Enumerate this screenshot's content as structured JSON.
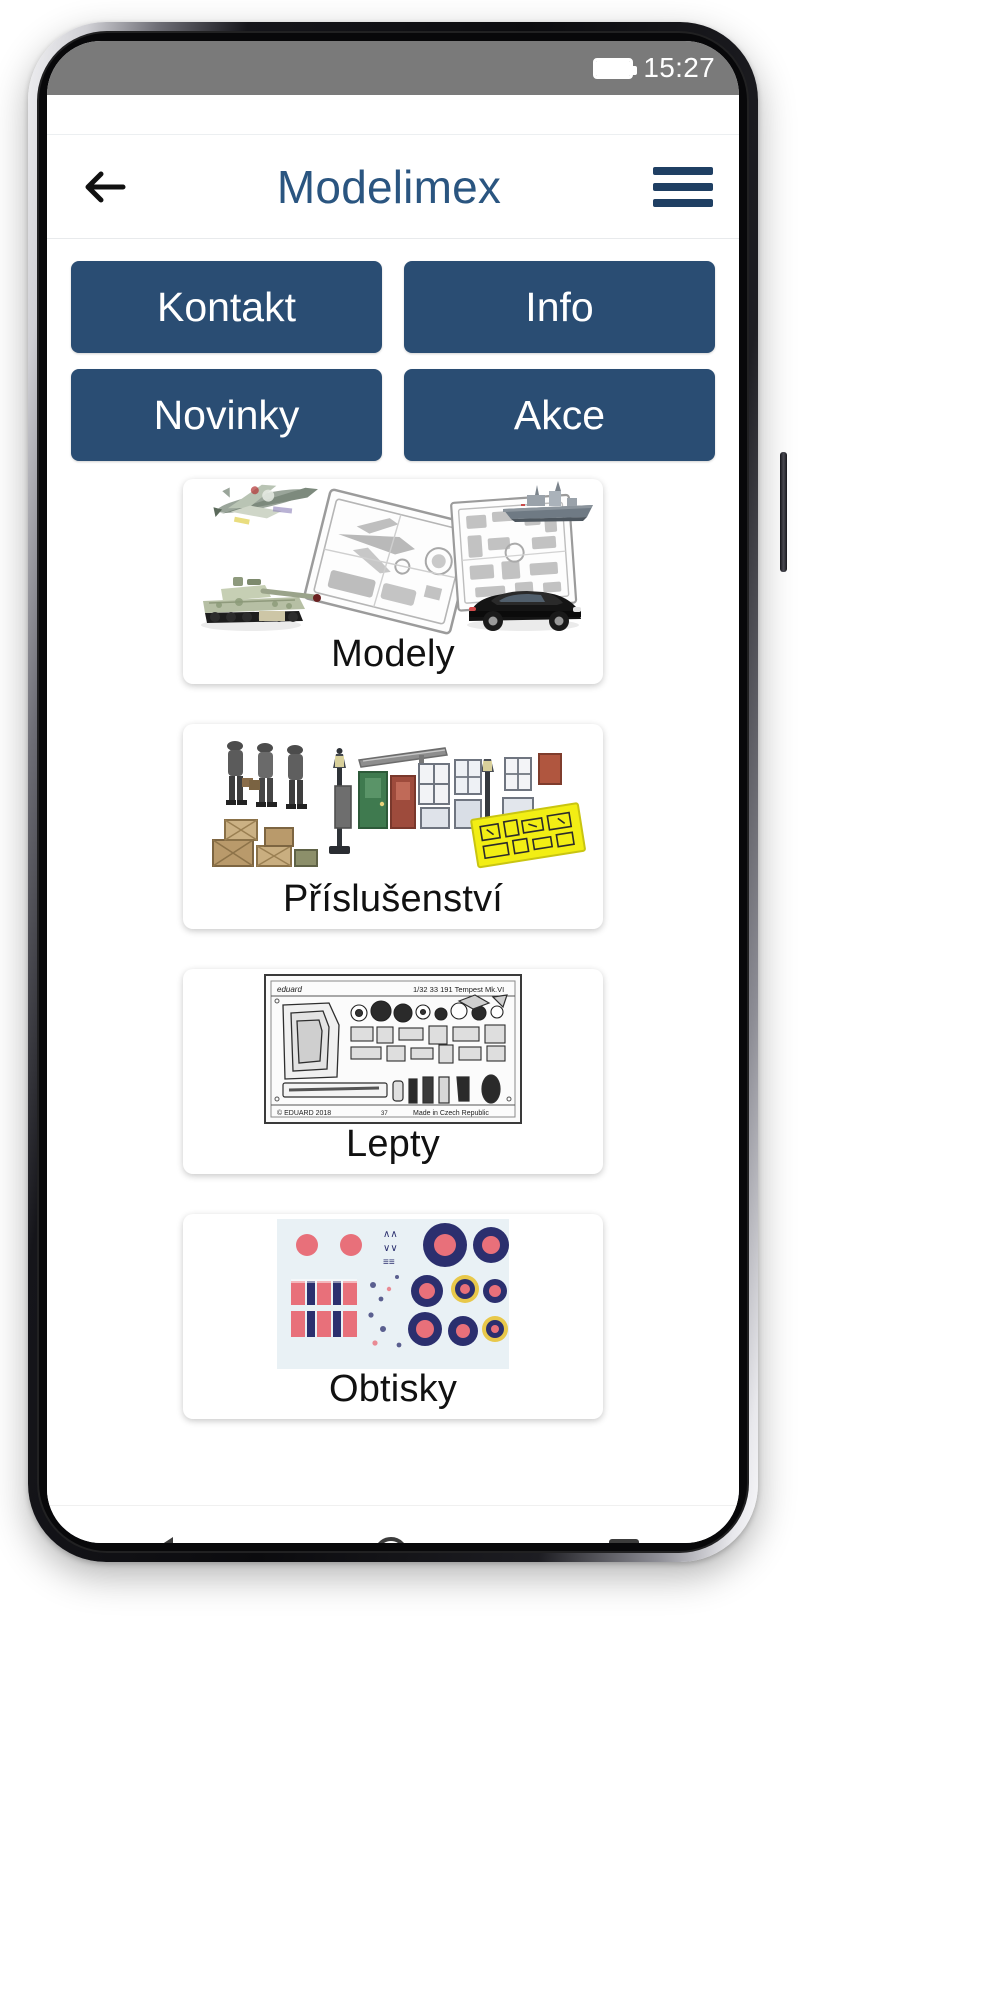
{
  "statusbar": {
    "time": "15:27",
    "battery_icon": "battery-icon"
  },
  "appbar": {
    "back_icon": "back-arrow-icon",
    "title": "Modelimex",
    "menu_icon": "hamburger-menu-icon"
  },
  "colors": {
    "brand_blue": "#2a4d73",
    "title_blue": "#2a5580",
    "statusbar_gray": "#7a7a7a",
    "card_label": "#111111",
    "page_background": "#ffffff"
  },
  "nav_buttons": [
    {
      "label": "Kontakt",
      "name": "kontakt"
    },
    {
      "label": "Info",
      "name": "info"
    },
    {
      "label": "Novinky",
      "name": "novinky"
    },
    {
      "label": "Akce",
      "name": "akce"
    }
  ],
  "categories": [
    {
      "label": "Modely",
      "name": "modely",
      "art": "model-kits-illustration",
      "art_items": [
        "airplane-model",
        "sprue-frame",
        "tank-model",
        "ship-model",
        "car-model"
      ]
    },
    {
      "label": "Příslušenství",
      "name": "prislusenstvi",
      "art": "accessories-illustration",
      "art_items": [
        "figures",
        "street-lamp",
        "doors-windows",
        "crates",
        "yellow-photoetch-sheet"
      ]
    },
    {
      "label": "Lepty",
      "name": "lepty",
      "art": "photo-etched-sheet-illustration",
      "sheet_header_left": "eduard",
      "sheet_header_right": "1/32   33 191   Tempest Mk.VI",
      "sheet_footer_left": "© EDUARD 2018",
      "sheet_footer_center": "37",
      "sheet_footer_right": "Made in Czech Republic"
    },
    {
      "label": "Obtisky",
      "name": "obtisky",
      "art": "decals-sheet-illustration",
      "art_items": [
        "roundels",
        "stripes",
        "markings"
      ]
    }
  ],
  "system_nav": {
    "back_label": "back-triangle-icon",
    "home_label": "home-circle-icon",
    "recents_label": "recents-square-icon"
  }
}
